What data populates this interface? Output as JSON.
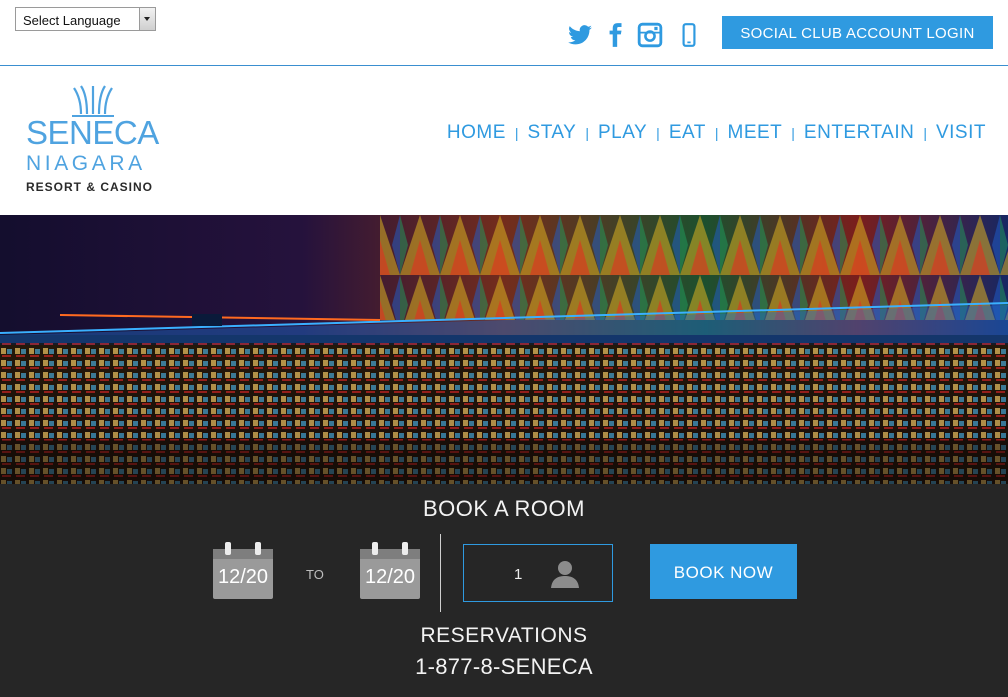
{
  "language_select": {
    "label": "Select Language"
  },
  "social": {
    "icons": [
      "twitter-icon",
      "facebook-icon",
      "instagram-icon",
      "phone-icon"
    ],
    "login_label": "SOCIAL CLUB ACCOUNT LOGIN"
  },
  "logo": {
    "line1": "SENECA",
    "line2": "NIAGARA",
    "line3": "RESORT & CASINO"
  },
  "nav": {
    "items": [
      "HOME",
      "STAY",
      "PLAY",
      "EAT",
      "MEET",
      "ENTERTAIN",
      "VISIT"
    ],
    "separator": "|"
  },
  "booking": {
    "title": "BOOK A ROOM",
    "checkin": "12/20",
    "to_label": "TO",
    "checkout": "12/20",
    "guests": "1",
    "book_button": "BOOK NOW",
    "reservations_label": "RESERVATIONS",
    "phone": "1-877-8-SENECA"
  },
  "colors": {
    "accent": "#2f9ae0",
    "booking_bg": "#262626",
    "logo_blue": "#4fa3e0"
  }
}
